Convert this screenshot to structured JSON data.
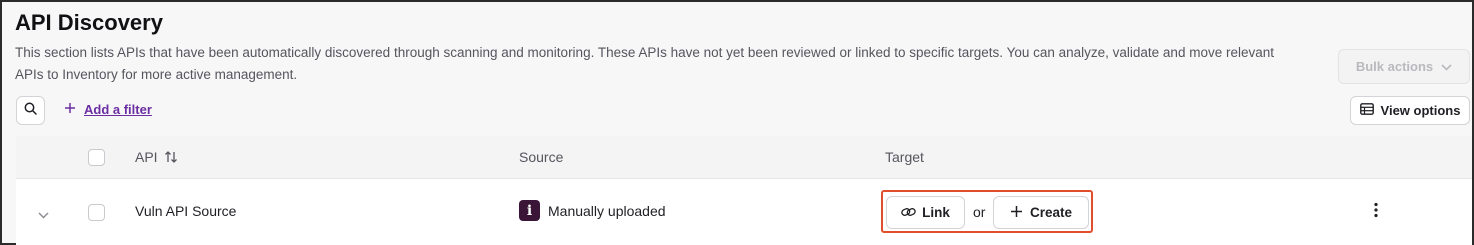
{
  "header": {
    "title": "API Discovery",
    "description": "This section lists APIs that have been automatically discovered through scanning and monitoring. These APIs have not yet been reviewed or linked to specific targets. You can analyze, validate and move relevant APIs to Inventory for more active management.",
    "bulk_actions_label": "Bulk actions",
    "bulk_actions_disabled": true
  },
  "toolbar": {
    "search_icon": "search-icon",
    "add_filter_label": "Add a filter",
    "view_options_label": "View options"
  },
  "table": {
    "columns": [
      "API",
      "Source",
      "Target"
    ],
    "rows": [
      {
        "api": "Vuln API Source",
        "source_badge_letter": "i",
        "source": "Manually uploaded",
        "target_link_label": "Link",
        "target_or_label": "or",
        "target_create_label": "Create"
      }
    ]
  },
  "colors": {
    "accent_link": "#6b2fa3",
    "highlight_border": "#e04e2c",
    "source_badge_bg": "#3a1538"
  }
}
